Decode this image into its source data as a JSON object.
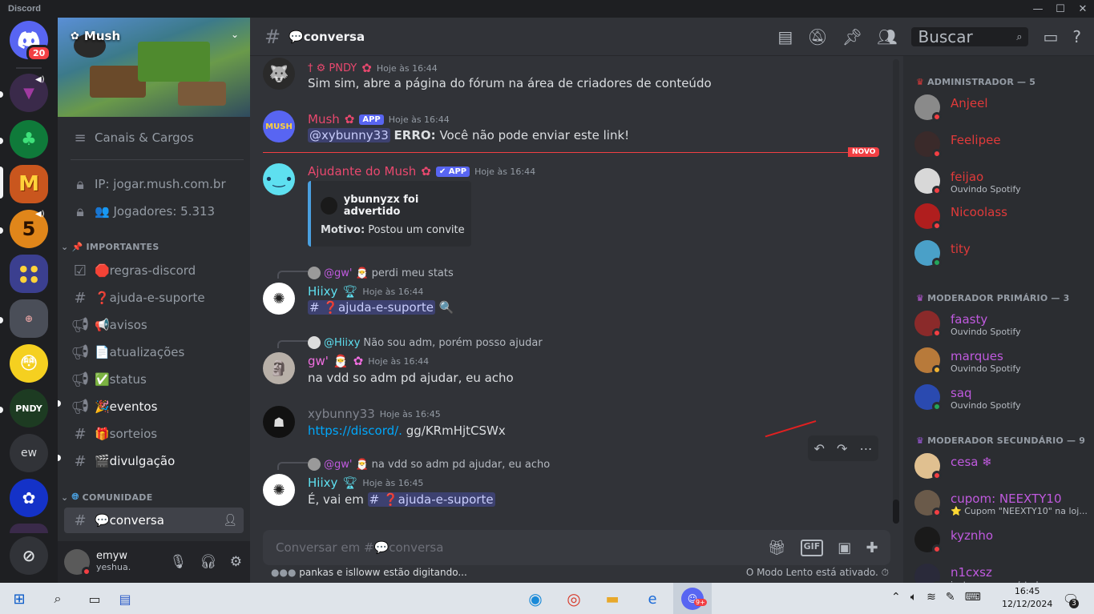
{
  "window": {
    "title": "Discord",
    "controls": [
      "—",
      "☐",
      "✕"
    ]
  },
  "servers": {
    "home_badge": "20",
    "items": [
      {
        "label": "",
        "color": "#5865f2"
      },
      {
        "label": "",
        "color": "#3a2a4a"
      },
      {
        "label": "",
        "color": "#0f7a3a"
      },
      {
        "label": "M",
        "color": "#c9561e"
      },
      {
        "label": "5",
        "color": "#e0861a"
      },
      {
        "label": "",
        "color": "#3b3f8f"
      },
      {
        "label": "",
        "color": "#4a4e58"
      },
      {
        "label": "",
        "color": "#f5d020"
      },
      {
        "label": "PNDY",
        "color": "#1d3b22"
      },
      {
        "label": "ew",
        "color": "#313338"
      },
      {
        "label": "",
        "color": "#1432c8"
      }
    ]
  },
  "sidebar": {
    "server_name": "Mush",
    "top_items": [
      {
        "icon": "≡",
        "label": "Canais & Cargos"
      },
      {
        "icon": "🔒",
        "label": "IP: jogar.mush.com.br"
      },
      {
        "icon": "🔒",
        "label": "👥 Jogadores: 5.313"
      }
    ],
    "categories": [
      {
        "label": "IMPORTANTES",
        "icon": "📌"
      },
      {
        "label": "COMUNIDADE",
        "icon": "🌐"
      }
    ],
    "channels_important": [
      {
        "icon": "☑",
        "label": "🛑regras-discord",
        "state": "read"
      },
      {
        "icon": "#",
        "label": "❓ajuda-e-suporte",
        "state": "read"
      },
      {
        "icon": "📢",
        "label": "📢avisos",
        "state": "read"
      },
      {
        "icon": "📢",
        "label": "📄atualizações",
        "state": "read"
      },
      {
        "icon": "📢",
        "label": "✅status",
        "state": "read"
      },
      {
        "icon": "📢",
        "label": "🎉eventos",
        "state": "unread"
      },
      {
        "icon": "#",
        "label": "🎁sorteios",
        "state": "read"
      },
      {
        "icon": "#",
        "label": "🎬divulgação",
        "state": "unread"
      }
    ],
    "channels_community": [
      {
        "icon": "#",
        "label": "💬conversa",
        "state": "active"
      }
    ]
  },
  "user_panel": {
    "name": "emyw",
    "status": "yeshua."
  },
  "chat": {
    "channel": "💬conversa",
    "search_placeholder": "Buscar",
    "new_label": "NOVO",
    "messages": [
      {
        "author": "† ⚙ PNDY",
        "author_color": "#e8486e",
        "time": "Hoje às 16:44",
        "text": "Sim sim, abre a página do fórum na área de criadores de conteúdo"
      },
      {
        "author": "Mush",
        "author_color": "#e8486e",
        "app_tag": "APP",
        "time": "Hoje às 16:44",
        "mention": "@xybunny33",
        "bold": "ERRO:",
        "text": "Você não pode enviar este link!"
      },
      {
        "author": "Ajudante do Mush",
        "author_color": "#e8486e",
        "app_tag": "✔ APP",
        "time": "Hoje às 16:44",
        "embed_title": "ybunnyzx foi advertido",
        "embed_label": "Motivo:",
        "embed_value": "Postou um convite"
      },
      {
        "reply_user": "@gw'",
        "reply_text": "perdi meu stats",
        "author": "Hiixy",
        "author_color": "#5ee0f0",
        "time": "Hoje às 16:44",
        "channel_mention": "# ❓ajuda-e-suporte",
        "emoji": "🔍"
      },
      {
        "reply_user": "@Hiixy",
        "reply_text": "Não sou adm, porém posso ajudar",
        "author": "gw'",
        "author_color": "#f06ee0",
        "time": "Hoje às 16:44",
        "text": "na vdd so adm pd ajudar, eu acho"
      },
      {
        "author": "xybunny33",
        "author_color": "#80848e",
        "time": "Hoje às 16:45",
        "link": "https://discord/.",
        "text": " gg/KRmHjtCSWx"
      },
      {
        "reply_user": "@gw'",
        "reply_text": "na vdd so adm pd ajudar, eu acho",
        "author": "Hiixy",
        "author_color": "#5ee0f0",
        "time": "Hoje às 16:45",
        "text": "É, vai em",
        "channel_mention": "# ❓ajuda-e-suporte"
      }
    ],
    "composer_placeholder": "Conversar em #💬conversa",
    "typing": "pankas e islloww estão digitando...",
    "slowmode": "O Modo Lento está ativado."
  },
  "members": {
    "groups": [
      {
        "title": "ADMINISTRADOR — 5",
        "icon_color": "#e03a3a",
        "items": [
          {
            "name": "Anjeel",
            "color": "#e03a3a",
            "sub": "",
            "avatar": "#8a8a8a",
            "status": "#f23f43"
          },
          {
            "name": "Feelipee",
            "color": "#e03a3a",
            "sub": "",
            "avatar": "#3a2a2a",
            "status": "#f23f43"
          },
          {
            "name": "feijao",
            "color": "#e03a3a",
            "sub": "Ouvindo Spotify",
            "avatar": "#d8d8d8",
            "status": "#f23f43"
          },
          {
            "name": "Nicoolass",
            "color": "#e03a3a",
            "sub": "",
            "avatar": "#b01e1e",
            "status": "#f23f43"
          },
          {
            "name": "tity",
            "color": "#e03a3a",
            "sub": "",
            "avatar": "#4aa0c8",
            "status": "#23a55a"
          }
        ]
      },
      {
        "title": "MODERADOR PRIMÁRIO — 3",
        "icon_color": "#c05adf",
        "items": [
          {
            "name": "faasty",
            "color": "#c05adf",
            "sub": "Ouvindo Spotify",
            "avatar": "#8a2a2a",
            "status": "#f23f43"
          },
          {
            "name": "marques",
            "color": "#c05adf",
            "sub": "Ouvindo Spotify",
            "avatar": "#b87a3a",
            "status": "#f0b232"
          },
          {
            "name": "saq",
            "color": "#c05adf",
            "sub": "Ouvindo Spotify",
            "avatar": "#2a4ab0",
            "status": "#23a55a"
          }
        ]
      },
      {
        "title": "MODERADOR SECUNDÁRIO — 9",
        "icon_color": "#a05adf",
        "items": [
          {
            "name": "cesa ❄",
            "color": "#c05adf",
            "sub": "",
            "avatar": "#e0c090",
            "status": "#f23f43"
          },
          {
            "name": "cupom: NEEXTY10",
            "color": "#c05adf",
            "sub": "⭐ Cupom \"NEEXTY10\" na loj...",
            "avatar": "#6a5a4a",
            "status": "#f23f43"
          },
          {
            "name": "kyznho",
            "color": "#c05adf",
            "sub": "",
            "avatar": "#1a1a1a",
            "status": "#f23f43"
          },
          {
            "name": "n1cxsz",
            "color": "#c05adf",
            "sub": "instagram.com/sto.lens",
            "avatar": "#2a2a3a",
            "status": "#f23f43"
          }
        ]
      }
    ]
  },
  "taskbar": {
    "time": "16:45",
    "date": "12/12/2024",
    "notification_count": "3",
    "discord_badge": "9+"
  }
}
